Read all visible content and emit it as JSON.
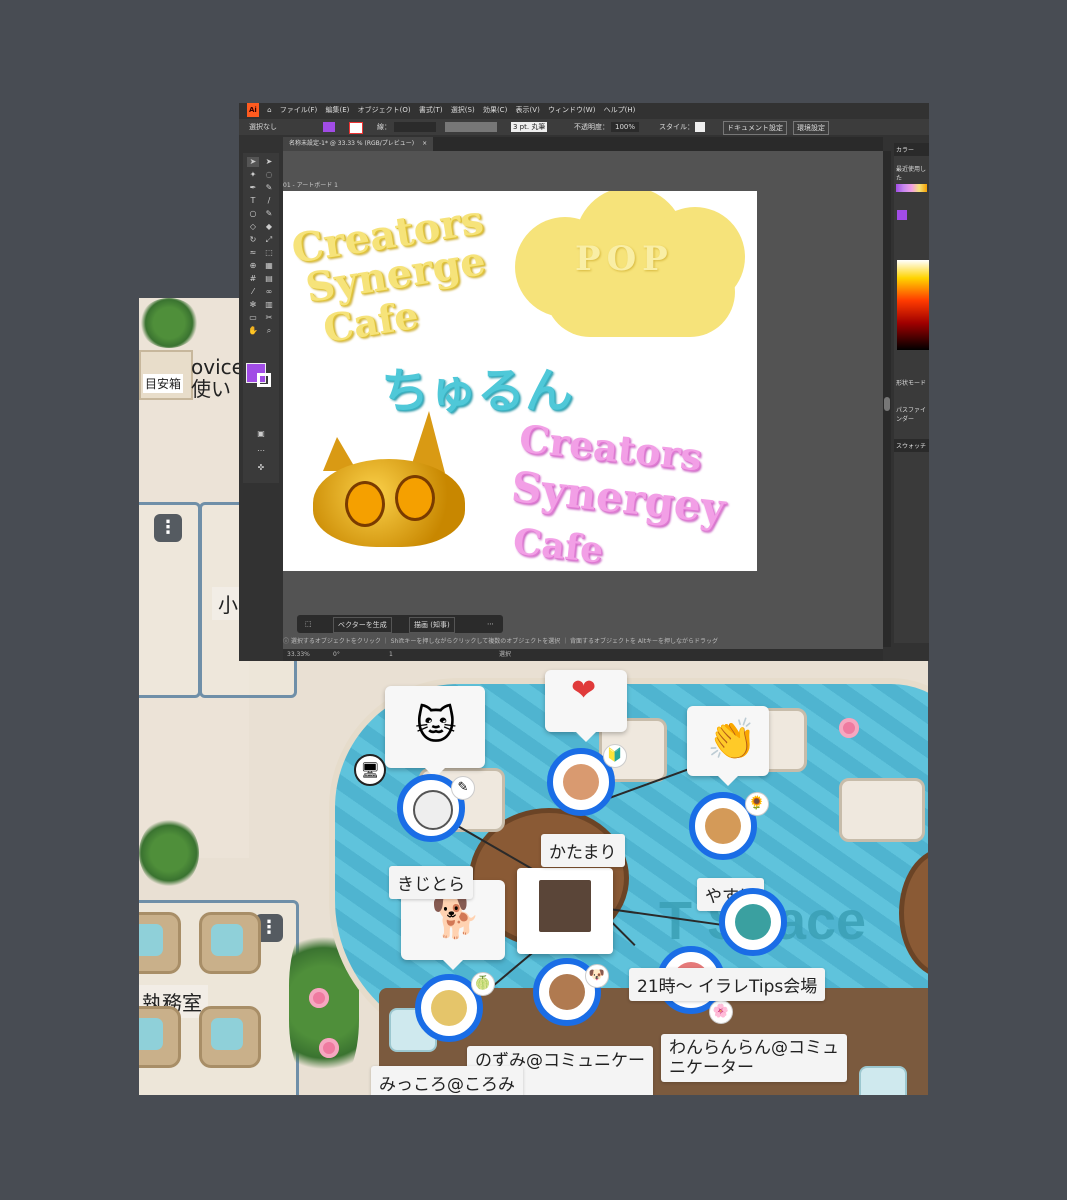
{
  "office": {
    "left_sign": "目安箱",
    "left_sign_text_line1": "ovice",
    "left_sign_text_line2": "使い",
    "room_small_label": "小",
    "room_office_label": "執務室",
    "space_text": "T  Space",
    "users": [
      {
        "name": "きじとら",
        "badge": "✎"
      },
      {
        "name": "かたまり",
        "badge": "🔰"
      },
      {
        "name": "やすは",
        "badge": "🌻"
      },
      {
        "name": "みっころ@ころみ",
        "badge": "🍈"
      },
      {
        "name": "のずみ@コミュニケー\nター",
        "badge": "🐶"
      },
      {
        "name": "わんらんらん@コミュ\nニケーター",
        "badge": "🌸"
      }
    ],
    "event_label": "21時〜 イラレTips会場",
    "screen_share_icon": "🖥",
    "stamps": [
      "🐱",
      "❤",
      "👏",
      "🐕"
    ]
  },
  "illustrator": {
    "menu": [
      "ファイル(F)",
      "編集(E)",
      "オブジェクト(O)",
      "書式(T)",
      "選択(S)",
      "効果(C)",
      "表示(V)",
      "ウィンドウ(W)",
      "ヘルプ(H)"
    ],
    "control_bar": {
      "selection": "選択なし",
      "stroke_label": "線：",
      "stroke_value": "3 pt. 丸筆",
      "opacity_label": "不透明度：",
      "opacity_value": "100%",
      "style_label": "スタイル：",
      "doc_settings": "ドキュメント設定",
      "preferences": "環境設定"
    },
    "tab_title": "名称未設定-1* @ 33.33 % (RGB/プレビュー)",
    "artboard_label": "01 - アートボード 1",
    "art": {
      "yellow_line1": "Creators",
      "yellow_line2": "Synerge",
      "yellow_line3": "Cafe",
      "cloud_text": "POP",
      "teal_text": "ちゅるん",
      "pink_line1": "Creators",
      "pink_line2": "Synergey",
      "pink_line3": "Cafe"
    },
    "context_bar": {
      "vector_btn": "ベクターを生成",
      "edit_btn": "描画 (知事)"
    },
    "status_text": "選択するオブジェクトをクリック ｜ Shiftキーを押しながらクリックして複数のオブジェクトを選択 ｜ 背面するオブジェクトを Altキーを押しながらドラッグ",
    "zoom_value": "33.33%",
    "rotation_value": "0°",
    "page_value": "1",
    "mode_text": "選択",
    "panels": {
      "color_tab": "カラー",
      "recent": "最近使用した",
      "shape_mode": "形状モード",
      "pathfinder": "パスファインダー",
      "swatches": "スウォッチ"
    },
    "colors": {
      "fill": "#a14ce6",
      "yellow": "#f6e37a",
      "pink": "#f29fe6",
      "teal": "#4fc8d8"
    }
  }
}
